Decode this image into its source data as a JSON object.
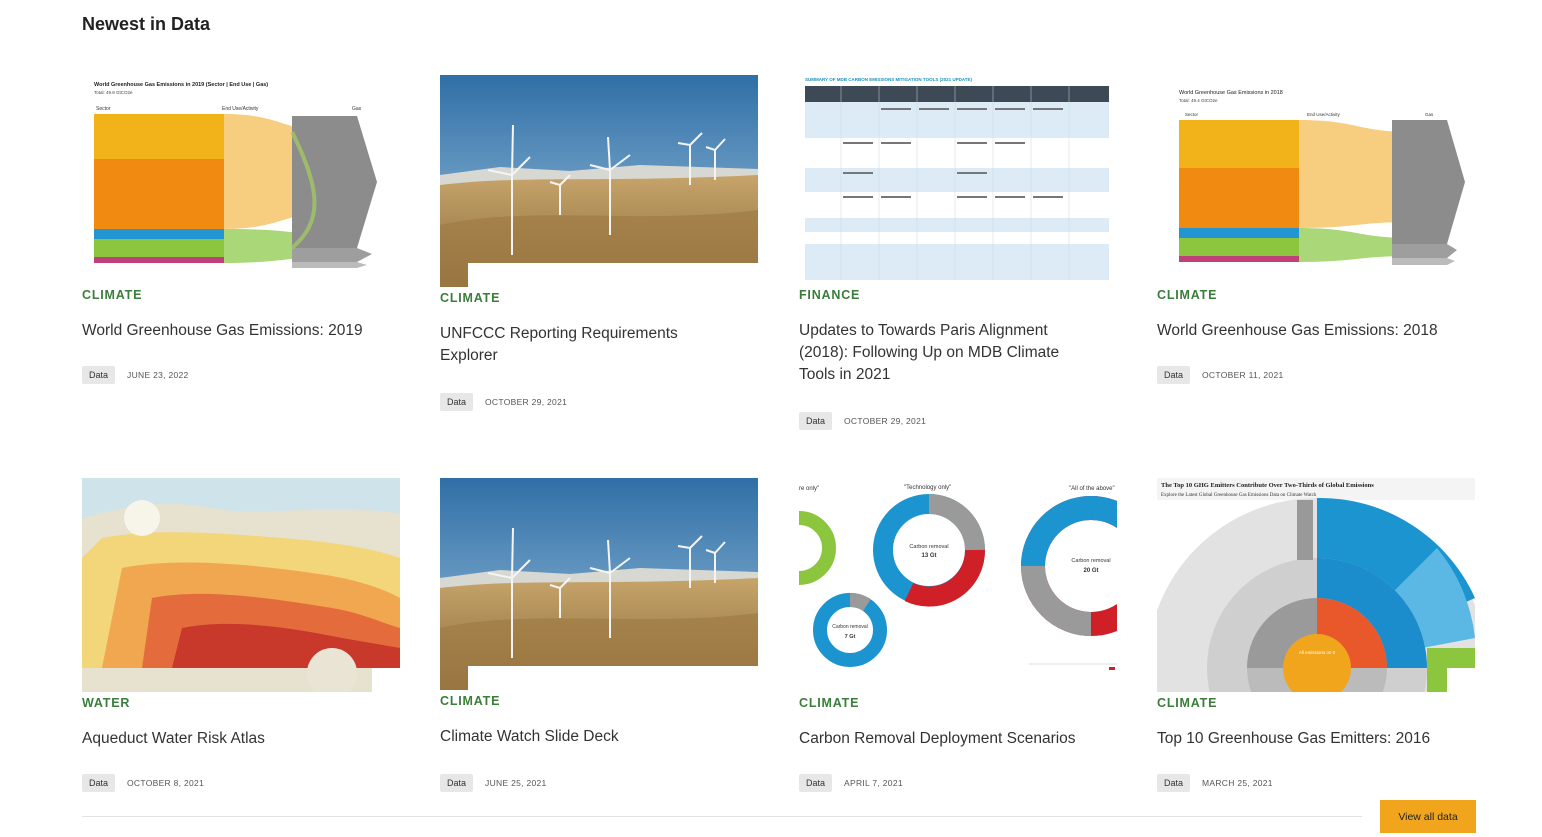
{
  "section": {
    "title": "Newest in Data"
  },
  "cards": [
    {
      "category": "CLIMATE",
      "title": "World Greenhouse Gas Emissions: 2019",
      "badge": "Data",
      "date": "JUNE 23, 2022",
      "thumb": {
        "heading": "World Greenhouse Gas Emissions in 2019 (Sector | End Use | Gas)",
        "sub": "Total: 49.8 GtCO2e",
        "col1": "Sector",
        "col2": "End Use/Activity",
        "col3": "Gas"
      }
    },
    {
      "category": "CLIMATE",
      "title": "UNFCCC Reporting Requirements Explorer",
      "badge": "Data",
      "date": "OCTOBER 29, 2021"
    },
    {
      "category": "FINANCE",
      "title": "Updates to Towards Paris Alignment (2018): Following Up on MDB Climate Tools in 2021",
      "badge": "Data",
      "date": "OCTOBER 29, 2021",
      "thumb": {
        "heading": "SUMMARY OF MDB CARBON EMISSIONS MITIGATION TOOLS (2021 UPDATE)"
      }
    },
    {
      "category": "CLIMATE",
      "title": "World Greenhouse Gas Emissions: 2018",
      "badge": "Data",
      "date": "OCTOBER 11, 2021",
      "thumb": {
        "heading": "World Greenhouse Gas Emissions in 2018",
        "sub": "Total: 49.4 GtCO2e",
        "col1": "Sector",
        "col2": "End Use/Activity",
        "col3": "Gas"
      }
    },
    {
      "category": "WATER",
      "title": "Aqueduct Water Risk Atlas",
      "badge": "Data",
      "date": "OCTOBER 8, 2021"
    },
    {
      "category": "CLIMATE",
      "title": "Climate Watch Slide Deck",
      "badge": "Data",
      "date": "JUNE 25, 2021"
    },
    {
      "category": "CLIMATE",
      "title": "Carbon Removal Deployment Scenarios",
      "badge": "Data",
      "date": "APRIL 7, 2021",
      "thumb": {
        "label_tech": "\"Technology only\"",
        "label_all": "\"All of the above\"",
        "label_left": "re only\"",
        "d1": "Carbon removal",
        "v1": "13 Gt",
        "d2": "Carbon removal",
        "v2": "20 Gt",
        "d3": "Carbon removal",
        "v3": "7 Gt"
      }
    },
    {
      "category": "CLIMATE",
      "title": "Top 10 Greenhouse Gas Emitters: 2016",
      "badge": "Data",
      "date": "MARCH 25, 2021",
      "thumb": {
        "heading": "The Top 10 GHG Emitters Contribute Over Two-Thirds of Global Emissions",
        "sub": "Explore the Latest Global Greenhouse Gas Emissions Data on Climate Watch",
        "center": "All emissions on 0"
      }
    }
  ],
  "actions": {
    "view_all": "View all data"
  }
}
